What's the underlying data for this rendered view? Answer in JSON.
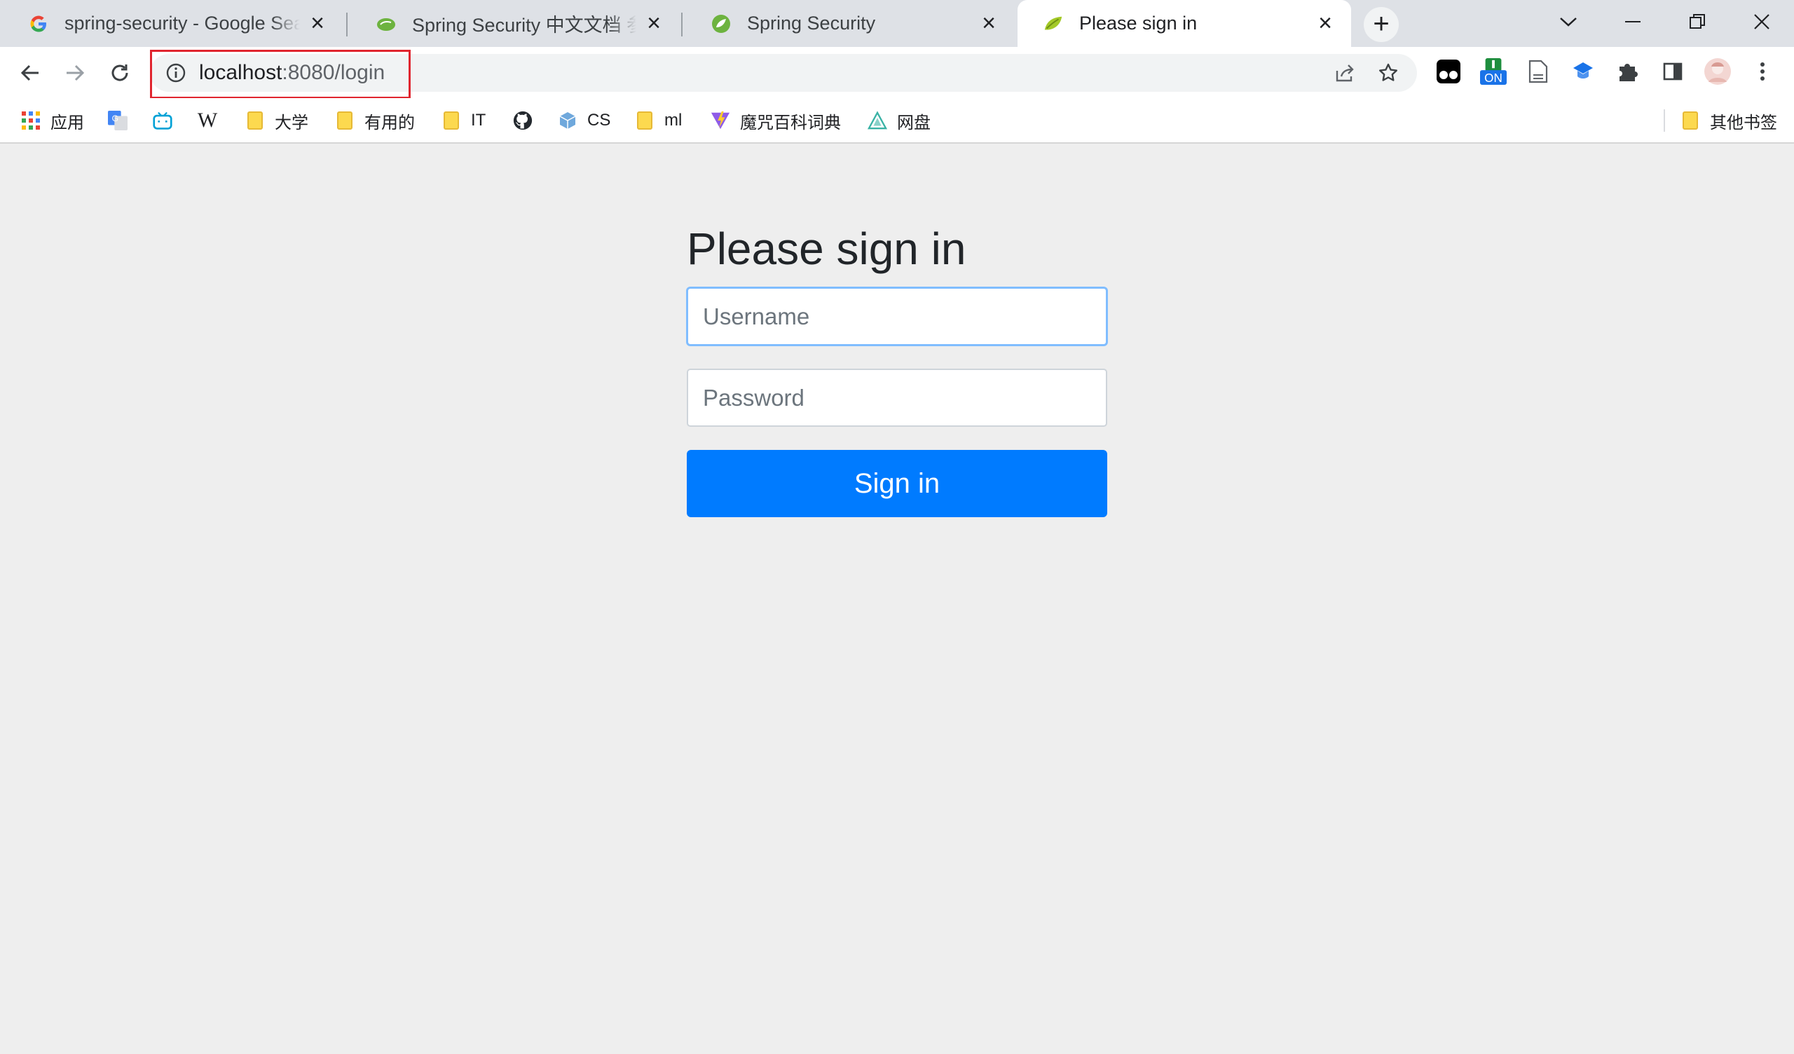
{
  "browser": {
    "tabs": [
      {
        "title": "spring-security - Google Search",
        "favicon": "google-icon",
        "active": false
      },
      {
        "title": "Spring Security 中文文档 参考手册",
        "favicon": "spring-cloud-icon",
        "active": false
      },
      {
        "title": "Spring Security",
        "favicon": "spring-leaf-icon",
        "active": false
      },
      {
        "title": "Please sign in",
        "favicon": "spring-leaf-icon",
        "active": true
      }
    ],
    "address_bar": {
      "host": "localhost",
      "path": ":8080/login"
    },
    "extensions": [
      {
        "icon": "tampermonkey-icon"
      },
      {
        "icon": "toggle-on-extension-icon",
        "badge": "ON"
      },
      {
        "icon": "page-icon"
      },
      {
        "icon": "mortarboard-icon"
      },
      {
        "icon": "puzzle-icon"
      },
      {
        "icon": "side-panel-icon"
      },
      {
        "icon": "profile-avatar"
      },
      {
        "icon": "more-vertical-icon"
      }
    ]
  },
  "bookmarks": {
    "items": [
      {
        "label": "应用",
        "icon": "apps-grid-icon"
      },
      {
        "label": "",
        "icon": "google-translate-icon"
      },
      {
        "label": "",
        "icon": "bilibili-icon"
      },
      {
        "label": "",
        "icon": "wikipedia-icon"
      },
      {
        "label": "大学",
        "icon": "folder-icon"
      },
      {
        "label": "有用的",
        "icon": "folder-icon"
      },
      {
        "label": "IT",
        "icon": "folder-icon"
      },
      {
        "label": "",
        "icon": "github-icon"
      },
      {
        "label": "CS",
        "icon": "cube-icon"
      },
      {
        "label": "ml",
        "icon": "folder-icon"
      },
      {
        "label": "魔咒百科词典",
        "icon": "vite-icon"
      },
      {
        "label": "网盘",
        "icon": "cloud-drive-icon"
      }
    ],
    "other": {
      "label": "其他书签",
      "icon": "folder-icon"
    }
  },
  "login": {
    "heading": "Please sign in",
    "username_placeholder": "Username",
    "password_placeholder": "Password",
    "submit_label": "Sign in"
  },
  "colors": {
    "primary_button": "#007bff",
    "highlight_box": "#e0252f",
    "page_background": "#eeeeee"
  }
}
